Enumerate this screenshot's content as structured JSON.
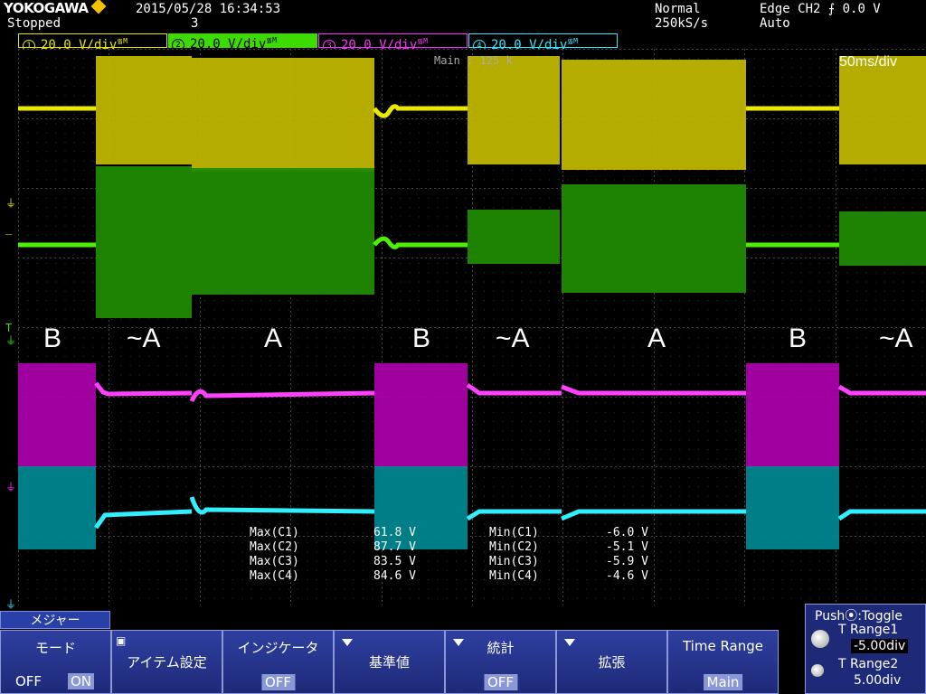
{
  "header": {
    "brand": "YOKOGAWA",
    "status": "Stopped",
    "datetime": "2015/05/28 16:34:53",
    "acq_count": "3",
    "acq_mode": "Normal",
    "sample_rate": "250kS/s",
    "trigger": "Edge CH2 ⨍ 0.0 V",
    "trigger_mode": "Auto"
  },
  "channels": [
    {
      "num": "1",
      "scale": "20.0 V/div",
      "color": "#e8e800",
      "bg": "#000000",
      "suffix": "᯾M"
    },
    {
      "num": "2",
      "scale": "20.0 V/div",
      "color": "#000000",
      "bg": "#3ddc00",
      "suffix": "᯾M"
    },
    {
      "num": "3",
      "scale": "20.0 V/div",
      "color": "#ff30ff",
      "bg": "#000000",
      "suffix": "᯾M"
    },
    {
      "num": "4",
      "scale": "20.0 V/div",
      "color": "#30e8ff",
      "bg": "#000000",
      "suffix": "᯾M"
    }
  ],
  "display": {
    "main_label": "Main : 125 k",
    "timebase": "50ms/div"
  },
  "mode_labels": [
    "B",
    "~A",
    "A",
    "B",
    "~A",
    "A",
    "B",
    "~A"
  ],
  "measurements": {
    "max_labels": [
      "Max(C1)",
      "Max(C2)",
      "Max(C3)",
      "Max(C4)"
    ],
    "max_values": [
      "61.8 V",
      "87.7 V",
      "83.5 V",
      "84.6 V"
    ],
    "min_labels": [
      "Min(C1)",
      "Min(C2)",
      "Min(C3)",
      "Min(C4)"
    ],
    "min_values": [
      "-6.0 V",
      "-5.1 V",
      "-5.9 V",
      "-4.6 V"
    ]
  },
  "menu": {
    "tab": "メジャー",
    "mode_title": "モード",
    "mode_off": "OFF",
    "mode_on": "ON",
    "items_title": "アイテム設定",
    "indicator_title": "インジケータ",
    "indicator_value": "OFF",
    "reference_title": "基準値",
    "stats_title": "統計",
    "stats_value": "OFF",
    "expand_title": "拡張",
    "time_range_title": "Time Range",
    "time_range_value": "Main",
    "push_toggle": "Push⦿:Toggle",
    "t_range1_label": "T Range1",
    "t_range1_value": "-5.00div",
    "t_range2_label": "T Range2",
    "t_range2_value": "5.00div"
  },
  "colors": {
    "ch1": "#e8e800",
    "ch2": "#3ddc00",
    "ch3": "#ff30ff",
    "ch4": "#30e8ff",
    "menu_bg": "#1e2a78"
  }
}
